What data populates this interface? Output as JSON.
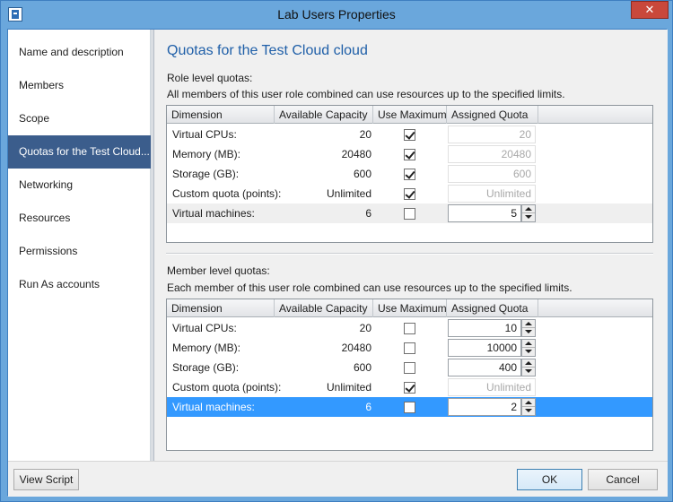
{
  "window": {
    "title": "Lab Users Properties",
    "close_glyph": "✕"
  },
  "nav": {
    "items": [
      {
        "label": "Name and description"
      },
      {
        "label": "Members"
      },
      {
        "label": "Scope"
      },
      {
        "label": "Quotas for the Test Cloud..."
      },
      {
        "label": "Networking"
      },
      {
        "label": "Resources"
      },
      {
        "label": "Permissions"
      },
      {
        "label": "Run As accounts"
      }
    ],
    "selected_index": 3
  },
  "main": {
    "heading": "Quotas for the Test Cloud cloud",
    "columns": [
      "Dimension",
      "Available Capacity",
      "Use Maximum",
      "Assigned Quota"
    ],
    "role": {
      "title": "Role level quotas:",
      "description": "All members of this user role combined can use resources up to the specified limits.",
      "rows": [
        {
          "dimension": "Virtual CPUs:",
          "capacity": "20",
          "use_max": true,
          "quota": "20"
        },
        {
          "dimension": "Memory (MB):",
          "capacity": "20480",
          "use_max": true,
          "quota": "20480"
        },
        {
          "dimension": "Storage (GB):",
          "capacity": "600",
          "use_max": true,
          "quota": "600"
        },
        {
          "dimension": "Custom quota (points):",
          "capacity": "Unlimited",
          "use_max": true,
          "quota": "Unlimited"
        },
        {
          "dimension": "Virtual machines:",
          "capacity": "6",
          "use_max": false,
          "quota": "5"
        }
      ]
    },
    "member": {
      "title": "Member level quotas:",
      "description": "Each member of this user role combined can use resources up to the specified limits.",
      "rows": [
        {
          "dimension": "Virtual CPUs:",
          "capacity": "20",
          "use_max": false,
          "quota": "10"
        },
        {
          "dimension": "Memory (MB):",
          "capacity": "20480",
          "use_max": false,
          "quota": "10000"
        },
        {
          "dimension": "Storage (GB):",
          "capacity": "600",
          "use_max": false,
          "quota": "400"
        },
        {
          "dimension": "Custom quota (points):",
          "capacity": "Unlimited",
          "use_max": true,
          "quota": "Unlimited"
        },
        {
          "dimension": "Virtual machines:",
          "capacity": "6",
          "use_max": false,
          "quota": "2"
        }
      ],
      "selected_row": 4
    }
  },
  "footer": {
    "view_script": "View Script",
    "ok": "OK",
    "cancel": "Cancel"
  }
}
